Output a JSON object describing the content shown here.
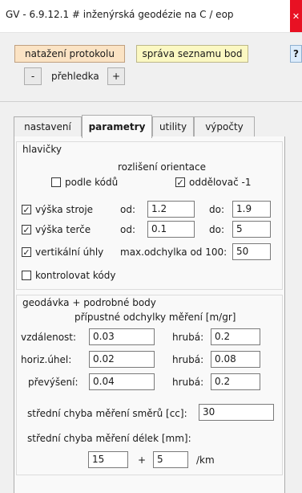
{
  "window": {
    "title": "GV - 6.9.12.1 # inženýrská geodézie na C / eop"
  },
  "toolbar": {
    "btn_protocol": "natažení protokolu",
    "btn_points": "správa seznamu bod",
    "btn_help": "?",
    "btn_minus": "-",
    "btn_overview": "přehledka",
    "btn_plus": "+"
  },
  "tabs": [
    "nastavení",
    "parametry",
    "utility",
    "výpočty"
  ],
  "headers": {
    "group_title": "hlavičky",
    "orientation_title": "rozlišení orientace",
    "by_codes": {
      "label": "podle kódů",
      "checked": false
    },
    "separator": {
      "label": "oddělovač -1",
      "checked": true
    },
    "instrument_height": {
      "label": "výška stroje",
      "checked": true,
      "from_label": "od:",
      "from": "1.2",
      "to_label": "do:",
      "to": "1.9"
    },
    "target_height": {
      "label": "výška terče",
      "checked": true,
      "from_label": "od:",
      "from": "0.1",
      "to_label": "do:",
      "to": "5"
    },
    "vertical_angles": {
      "label": "vertikální úhly",
      "checked": true,
      "max_label": "max.odchylka od 100:",
      "max": "50"
    },
    "check_codes": {
      "label": "kontrolovat kódy",
      "checked": false
    }
  },
  "surveying": {
    "group_title": "geodávka + podrobné body",
    "subtitle": "přípustné odchylky měření [m/gr]",
    "rows": [
      {
        "label": "vzdálenost:",
        "value": "0.03",
        "gross_label": "hrubá:",
        "gross": "0.2"
      },
      {
        "label": "horiz.úhel:",
        "value": "0.02",
        "gross_label": "hrubá:",
        "gross": "0.08"
      },
      {
        "label": "převýšení:",
        "value": "0.04",
        "gross_label": "hrubá:",
        "gross": "0.2"
      }
    ],
    "dir_error_label": "střední chyba měření směrů [cc]:",
    "dir_error": "30",
    "len_error_label": "střední chyba měření délek [mm]:",
    "len_error_a": "15",
    "plus": "+",
    "len_error_b": "5",
    "unit": "/km"
  }
}
